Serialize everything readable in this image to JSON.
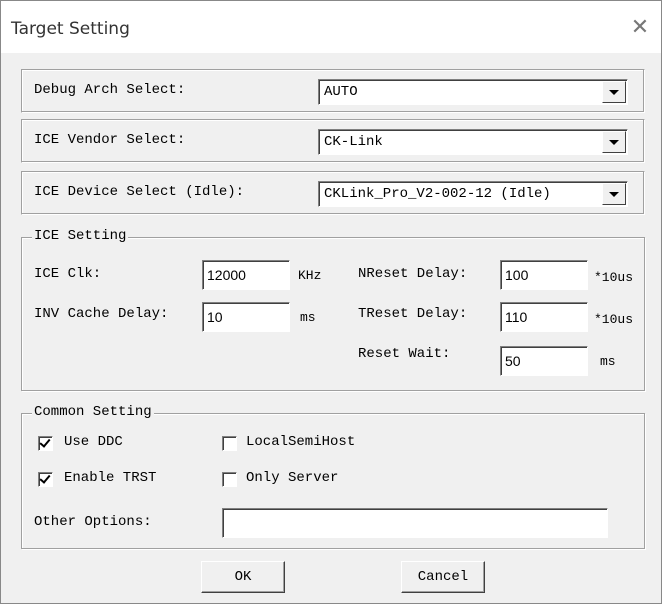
{
  "window": {
    "title": "Target Setting",
    "close_glyph": "✕"
  },
  "debug_arch": {
    "label": "Debug Arch Select:",
    "value": "AUTO"
  },
  "ice_vendor": {
    "label": "ICE Vendor Select:",
    "value": "CK-Link"
  },
  "ice_device": {
    "label": "ICE Device Select (Idle):",
    "value": "CKLink_Pro_V2-002-12 (Idle)"
  },
  "ice_setting": {
    "legend": "ICE Setting",
    "ice_clk": {
      "label": "ICE Clk:",
      "value": "12000",
      "unit": "KHz"
    },
    "inv_cache_delay": {
      "label": "INV Cache Delay:",
      "value": "10",
      "unit": "ms"
    },
    "nreset_delay": {
      "label": "NReset Delay:",
      "value": "100",
      "unit": "*10us"
    },
    "treset_delay": {
      "label": "TReset Delay:",
      "value": "110",
      "unit": "*10us"
    },
    "reset_wait": {
      "label": "Reset Wait:",
      "value": "50",
      "unit": "ms"
    }
  },
  "common_setting": {
    "legend": "Common Setting",
    "use_ddc": {
      "label": "Use DDC",
      "checked": true
    },
    "enable_trst": {
      "label": "Enable TRST",
      "checked": true
    },
    "local_semihost": {
      "label": "LocalSemiHost",
      "checked": false
    },
    "only_server": {
      "label": "Only Server",
      "checked": false
    },
    "other_options": {
      "label": "Other Options:",
      "value": ""
    }
  },
  "buttons": {
    "ok": "OK",
    "cancel": "Cancel"
  }
}
